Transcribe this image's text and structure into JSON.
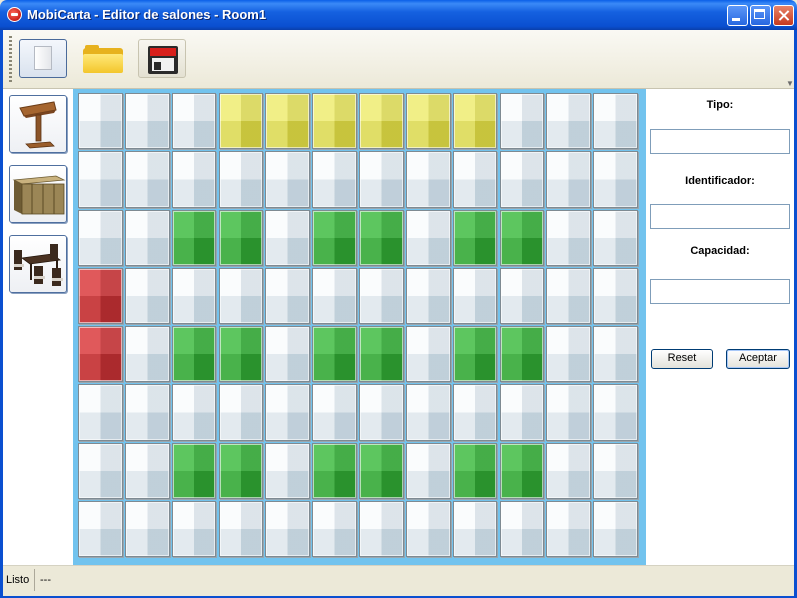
{
  "window": {
    "title": "MobiCarta - Editor de salones - Room1",
    "icon": "app-icon",
    "controls": [
      "minimize-icon",
      "maximize-icon",
      "close-icon"
    ]
  },
  "toolbar": {
    "buttons": [
      {
        "name": "new",
        "icon": "new-document-icon"
      },
      {
        "name": "open",
        "icon": "folder-open-icon"
      },
      {
        "name": "save",
        "icon": "floppy-save-icon"
      }
    ]
  },
  "palette": {
    "items": [
      {
        "name": "lectern",
        "icon": "lectern-icon"
      },
      {
        "name": "bar-counter",
        "icon": "bar-counter-icon"
      },
      {
        "name": "dining-table",
        "icon": "dining-table-icon"
      }
    ]
  },
  "room_grid": {
    "rows": 8,
    "cols": 12,
    "colors": {
      "floor": "#DDE8EE",
      "yellow": "#E2DE4E",
      "green": "#37B03A",
      "red": "#D0373A",
      "background": "#72C3EE"
    },
    "highlights": [
      {
        "row": 0,
        "col": 3,
        "color": "yellow"
      },
      {
        "row": 0,
        "col": 4,
        "color": "yellow"
      },
      {
        "row": 0,
        "col": 5,
        "color": "yellow"
      },
      {
        "row": 0,
        "col": 6,
        "color": "yellow"
      },
      {
        "row": 0,
        "col": 7,
        "color": "yellow"
      },
      {
        "row": 0,
        "col": 8,
        "color": "yellow"
      },
      {
        "row": 2,
        "col": 2,
        "color": "green"
      },
      {
        "row": 2,
        "col": 3,
        "color": "green"
      },
      {
        "row": 2,
        "col": 5,
        "color": "green"
      },
      {
        "row": 2,
        "col": 6,
        "color": "green"
      },
      {
        "row": 2,
        "col": 8,
        "color": "green"
      },
      {
        "row": 2,
        "col": 9,
        "color": "green"
      },
      {
        "row": 3,
        "col": 0,
        "color": "red"
      },
      {
        "row": 4,
        "col": 0,
        "color": "red"
      },
      {
        "row": 4,
        "col": 2,
        "color": "green"
      },
      {
        "row": 4,
        "col": 3,
        "color": "green"
      },
      {
        "row": 4,
        "col": 5,
        "color": "green"
      },
      {
        "row": 4,
        "col": 6,
        "color": "green"
      },
      {
        "row": 4,
        "col": 8,
        "color": "green"
      },
      {
        "row": 4,
        "col": 9,
        "color": "green"
      },
      {
        "row": 6,
        "col": 2,
        "color": "green"
      },
      {
        "row": 6,
        "col": 3,
        "color": "green"
      },
      {
        "row": 6,
        "col": 5,
        "color": "green"
      },
      {
        "row": 6,
        "col": 6,
        "color": "green"
      },
      {
        "row": 6,
        "col": 8,
        "color": "green"
      },
      {
        "row": 6,
        "col": 9,
        "color": "green"
      }
    ]
  },
  "properties": {
    "tipo_label": "Tipo:",
    "tipo_value": "",
    "identificador_label": "Identificador:",
    "identificador_value": "",
    "capacidad_label": "Capacidad:",
    "capacidad_value": "",
    "reset_label": "Reset",
    "accept_label": "Aceptar"
  },
  "statusbar": {
    "status": "Listo",
    "info": "---"
  }
}
